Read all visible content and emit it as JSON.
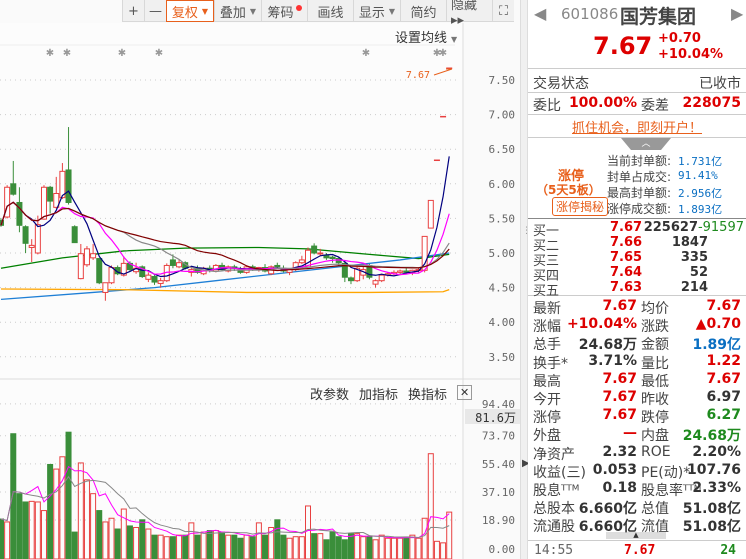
{
  "toolbar": {
    "buttons": [
      {
        "label": "+",
        "dropdown": false
      },
      {
        "label": "—",
        "dropdown": false
      },
      {
        "label": "复权",
        "dropdown": true,
        "selected": true
      },
      {
        "label": "叠加",
        "dropdown": true
      },
      {
        "label": "筹码",
        "dropdown": false,
        "dot": true
      },
      {
        "label": "画线",
        "dropdown": false
      },
      {
        "label": "显示",
        "dropdown": true
      },
      {
        "label": "简约",
        "dropdown": false
      },
      {
        "label": "隐藏 ▸▸",
        "dropdown": false
      }
    ],
    "expand_icon": "fullscreen-icon"
  },
  "chart": {
    "set_ma_label": "设置均线",
    "last_price_label": "7.67",
    "price_ticks": [
      "7.50",
      "7.00",
      "6.50",
      "6.00",
      "5.50",
      "5.00",
      "4.50",
      "4.00",
      "3.50"
    ],
    "volume_buttons": [
      "改参数",
      "加指标",
      "换指标"
    ],
    "volume_ticks": [
      "94.40",
      "73.70",
      "55.40",
      "37.10",
      "18.90",
      "0.00"
    ],
    "volume_cursor_label": "81.6万",
    "colors": {
      "up": "#e84040",
      "down": "#3a8e3a",
      "ma5": "#000080",
      "ma10": "#ff00ff",
      "ma20": "#888888",
      "ma30": "#800000"
    }
  },
  "chart_data": {
    "type": "candlestick",
    "price_range": [
      3.3,
      7.67
    ],
    "volume_range": [
      0,
      94.4
    ],
    "ohlc": [
      [
        5.47,
        5.5,
        5.38,
        5.4
      ],
      [
        5.52,
        5.98,
        5.5,
        5.95
      ],
      [
        6.0,
        6.33,
        5.83,
        5.85
      ],
      [
        5.73,
        5.95,
        5.3,
        5.4
      ],
      [
        5.38,
        5.4,
        5.0,
        5.14
      ],
      [
        5.08,
        5.2,
        4.87,
        5.11
      ],
      [
        5.0,
        5.54,
        4.98,
        5.41
      ],
      [
        5.49,
        5.98,
        5.48,
        5.95
      ],
      [
        5.95,
        5.97,
        5.57,
        5.75
      ],
      [
        5.66,
        6.1,
        5.64,
        5.86
      ],
      [
        5.8,
        6.3,
        5.78,
        6.18
      ],
      [
        6.2,
        6.82,
        5.7,
        5.73
      ],
      [
        5.38,
        5.4,
        5.15,
        5.15
      ],
      [
        4.63,
        5.13,
        4.62,
        4.99
      ],
      [
        4.83,
        5.1,
        4.8,
        5.06
      ],
      [
        4.93,
        5.13,
        4.9,
        4.99
      ],
      [
        4.92,
        4.93,
        4.55,
        4.57
      ],
      [
        4.43,
        4.57,
        4.31,
        4.57
      ],
      [
        4.57,
        4.82,
        4.55,
        4.79
      ],
      [
        4.79,
        4.82,
        4.68,
        4.7
      ],
      [
        4.68,
        4.95,
        4.66,
        4.85
      ],
      [
        4.85,
        4.88,
        4.74,
        4.76
      ],
      [
        4.73,
        4.86,
        4.7,
        4.78
      ],
      [
        4.8,
        4.82,
        4.64,
        4.66
      ],
      [
        4.62,
        4.72,
        4.58,
        4.68
      ],
      [
        4.66,
        4.68,
        4.54,
        4.58
      ],
      [
        4.56,
        4.64,
        4.5,
        4.6
      ],
      [
        4.6,
        4.85,
        4.58,
        4.82
      ],
      [
        4.9,
        4.98,
        4.78,
        4.82
      ],
      [
        4.8,
        4.9,
        4.78,
        4.86
      ],
      [
        4.86,
        4.88,
        4.76,
        4.78
      ],
      [
        4.72,
        4.78,
        4.66,
        4.76
      ],
      [
        4.78,
        4.82,
        4.7,
        4.72
      ],
      [
        4.7,
        4.8,
        4.68,
        4.78
      ],
      [
        4.78,
        4.82,
        4.72,
        4.75
      ],
      [
        4.74,
        4.84,
        4.72,
        4.82
      ],
      [
        4.82,
        4.86,
        4.74,
        4.76
      ],
      [
        4.74,
        4.82,
        4.72,
        4.8
      ],
      [
        4.8,
        4.83,
        4.74,
        4.78
      ],
      [
        4.76,
        4.8,
        4.7,
        4.72
      ],
      [
        4.72,
        4.82,
        4.7,
        4.8
      ],
      [
        4.8,
        4.83,
        4.74,
        4.77
      ],
      [
        4.76,
        4.8,
        4.73,
        4.79
      ],
      [
        4.79,
        4.84,
        4.72,
        4.74
      ],
      [
        4.7,
        4.82,
        4.68,
        4.8
      ],
      [
        4.82,
        4.86,
        4.78,
        4.8
      ],
      [
        4.78,
        4.82,
        4.72,
        4.74
      ],
      [
        4.72,
        4.78,
        4.68,
        4.76
      ],
      [
        4.76,
        4.88,
        4.74,
        4.86
      ],
      [
        4.86,
        4.96,
        4.84,
        4.9
      ],
      [
        4.8,
        5.08,
        4.8,
        5.04
      ],
      [
        5.1,
        5.14,
        4.98,
        5.0
      ],
      [
        5.0,
        5.06,
        4.96,
        5.0
      ],
      [
        4.97,
        5.0,
        4.9,
        4.93
      ],
      [
        4.94,
        4.96,
        4.86,
        4.92
      ],
      [
        4.92,
        4.94,
        4.82,
        4.86
      ],
      [
        4.85,
        4.88,
        4.58,
        4.65
      ],
      [
        4.64,
        4.66,
        4.55,
        4.6
      ],
      [
        4.6,
        4.8,
        4.58,
        4.78
      ],
      [
        4.68,
        4.8,
        4.62,
        4.76
      ],
      [
        4.82,
        4.84,
        4.62,
        4.65
      ],
      [
        4.55,
        4.62,
        4.5,
        4.6
      ],
      [
        4.6,
        4.7,
        4.58,
        4.68
      ],
      [
        4.68,
        4.72,
        4.66,
        4.7
      ],
      [
        4.7,
        4.75,
        4.68,
        4.72
      ],
      [
        4.72,
        4.76,
        4.68,
        4.74
      ],
      [
        4.74,
        4.78,
        4.7,
        4.72
      ],
      [
        4.72,
        4.76,
        4.68,
        4.75
      ],
      [
        4.75,
        4.78,
        4.72,
        4.76
      ],
      [
        4.75,
        5.24,
        4.72,
        5.24
      ],
      [
        5.36,
        5.76,
        5.36,
        5.76
      ],
      [
        6.34,
        6.34,
        6.34,
        6.34
      ],
      [
        6.97,
        6.97,
        6.97,
        6.97
      ],
      [
        7.67,
        7.67,
        7.67,
        7.67
      ]
    ],
    "volume": [
      19.5,
      17.6,
      75,
      36,
      30.6,
      31,
      30.6,
      25,
      55,
      52,
      60,
      76,
      11,
      56,
      45,
      36,
      25,
      17.6,
      20,
      13,
      26,
      15,
      14,
      19,
      13,
      9,
      9,
      8,
      8,
      9,
      9,
      17,
      9,
      11,
      12,
      12,
      11,
      9,
      9,
      7,
      9,
      8,
      17,
      9,
      14,
      19,
      9,
      7,
      8,
      8,
      28,
      10,
      10,
      6,
      11,
      8,
      6,
      10,
      10,
      8,
      8,
      6,
      9,
      7,
      7,
      7,
      7,
      9,
      7,
      20,
      62,
      5,
      4,
      24
    ],
    "long_ma": [
      {
        "color": "#008000",
        "points": [
          [
            0,
            4.78
          ],
          [
            10,
            4.93
          ],
          [
            20,
            5.03
          ],
          [
            30,
            5.07
          ],
          [
            42,
            5.08
          ],
          [
            50,
            5.06
          ],
          [
            60,
            4.98
          ],
          [
            68,
            4.92
          ],
          [
            73,
            4.98
          ]
        ]
      },
      {
        "color": "#1e7fd6",
        "points": [
          [
            0,
            4.33
          ],
          [
            15,
            4.43
          ],
          [
            25,
            4.5
          ],
          [
            35,
            4.6
          ],
          [
            45,
            4.7
          ],
          [
            55,
            4.8
          ],
          [
            65,
            4.9
          ],
          [
            73,
            5.0
          ]
        ]
      },
      {
        "color": "#ffa500",
        "points": [
          [
            0,
            4.48
          ],
          [
            20,
            4.47
          ],
          [
            40,
            4.43
          ],
          [
            60,
            4.43
          ],
          [
            72,
            4.44
          ],
          [
            73,
            4.47
          ]
        ]
      }
    ]
  },
  "quote": {
    "code": "601086",
    "name": "国芳集团",
    "price": "7.67",
    "change": "+0.70",
    "change_pct": "+10.04%",
    "status_label": "交易状态",
    "status_value": "已收市",
    "weibi_label": "委比",
    "weibi_value": "100.00%",
    "weicha_label": "委差",
    "weicha_value": "228075",
    "promo": "抓住机会，即刻开户！",
    "limit_title": "涨停",
    "limit_days": "（5天5板）",
    "limit_button": "涨停揭秘",
    "limit_stats": [
      {
        "label": "当前封单额:",
        "value": "1.731亿"
      },
      {
        "label": "封单占成交:",
        "value": "91.41%"
      },
      {
        "label": "最高封单额:",
        "value": "2.956亿"
      },
      {
        "label": "涨停成交额:",
        "value": "1.893亿"
      }
    ],
    "bids": [
      {
        "label": "买一",
        "price": "7.67",
        "vol": "225627",
        "delta": "-91597"
      },
      {
        "label": "买二",
        "price": "7.66",
        "vol": "1847"
      },
      {
        "label": "买三",
        "price": "7.65",
        "vol": "335"
      },
      {
        "label": "买四",
        "price": "7.64",
        "vol": "52"
      },
      {
        "label": "买五",
        "price": "7.63",
        "vol": "214"
      }
    ],
    "stats": [
      {
        "l1": "最新",
        "v1": "7.67",
        "c1": "red",
        "l2": "均价",
        "v2": "7.67",
        "c2": "red"
      },
      {
        "l1": "涨幅",
        "v1": "+10.04%",
        "c1": "red",
        "l2": "涨跌",
        "v2": "▲0.70",
        "c2": "red"
      },
      {
        "l1": "总手",
        "v1": "24.68万",
        "c1": "dark",
        "l2": "金额",
        "v2": "1.89亿",
        "c2": "blue"
      },
      {
        "l1": "换手*",
        "v1": "3.71%",
        "c1": "dark",
        "l2": "量比",
        "v2": "1.22",
        "c2": "red"
      },
      {
        "l1": "最高",
        "v1": "7.67",
        "c1": "red",
        "l2": "最低",
        "v2": "7.67",
        "c2": "red"
      },
      {
        "l1": "今开",
        "v1": "7.67",
        "c1": "red",
        "l2": "昨收",
        "v2": "6.97",
        "c2": "dark"
      },
      {
        "l1": "涨停",
        "v1": "7.67",
        "c1": "red",
        "l2": "跌停",
        "v2": "6.27",
        "c2": "green"
      },
      {
        "l1": "外盘",
        "v1": "—",
        "c1": "red",
        "l2": "内盘",
        "v2": "24.68万",
        "c2": "green"
      },
      {
        "l1": "净资产",
        "v1": "2.32",
        "c1": "dark",
        "l2": "ROE",
        "v2": "2.20%",
        "c2": "dark"
      },
      {
        "l1": "收益(三)",
        "v1": "0.053",
        "c1": "dark",
        "l2": "PE(动)*",
        "v2": "107.76",
        "c2": "dark"
      },
      {
        "l1": "股息ᵀᵀᴹ",
        "v1": "0.18",
        "c1": "dark",
        "l2": "股息率ᵀᵀᴹ",
        "v2": "2.33%",
        "c2": "dark"
      },
      {
        "l1": "总股本",
        "v1": "6.660亿",
        "c1": "dark",
        "l2": "总值",
        "v2": "51.08亿",
        "c2": "dark"
      },
      {
        "l1": "流通股",
        "v1": "6.660亿",
        "c1": "dark",
        "l2": "流值",
        "v2": "51.08亿",
        "c2": "dark"
      }
    ],
    "tick": {
      "time": "14:55",
      "price": "7.67",
      "vol": "24"
    }
  }
}
